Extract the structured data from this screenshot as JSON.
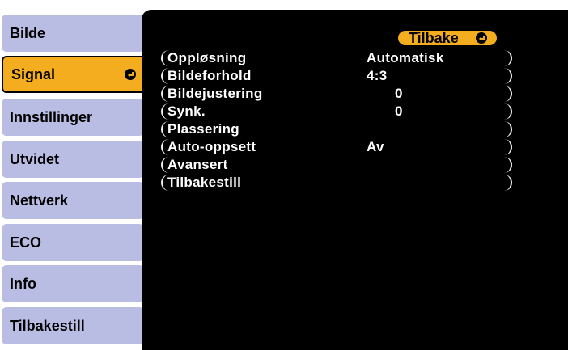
{
  "tabs": [
    {
      "label": "Bilde",
      "active": false
    },
    {
      "label": "Signal",
      "active": true
    },
    {
      "label": "Innstillinger",
      "active": false
    },
    {
      "label": "Utvidet",
      "active": false
    },
    {
      "label": "Nettverk",
      "active": false
    },
    {
      "label": "ECO",
      "active": false
    },
    {
      "label": "Info",
      "active": false
    },
    {
      "label": "Tilbakestill",
      "active": false
    }
  ],
  "back_button": {
    "label": "Tilbake",
    "icon": "enter-icon"
  },
  "menu_items": [
    {
      "label": "Oppløsning",
      "value": "Automatisk"
    },
    {
      "label": "Bildeforhold",
      "value": "4:3"
    },
    {
      "label": "Bildejustering",
      "value": "0"
    },
    {
      "label": "Synk.",
      "value": "0"
    },
    {
      "label": "Plassering",
      "value": ""
    },
    {
      "label": "Auto-oppsett",
      "value": "Av"
    },
    {
      "label": "Avansert",
      "value": ""
    },
    {
      "label": "Tilbakestill",
      "value": ""
    }
  ],
  "colors": {
    "tab_inactive": "#b9bde3",
    "tab_active": "#f5ad20",
    "panel": "#000000",
    "highlight": "#f5ad20"
  }
}
